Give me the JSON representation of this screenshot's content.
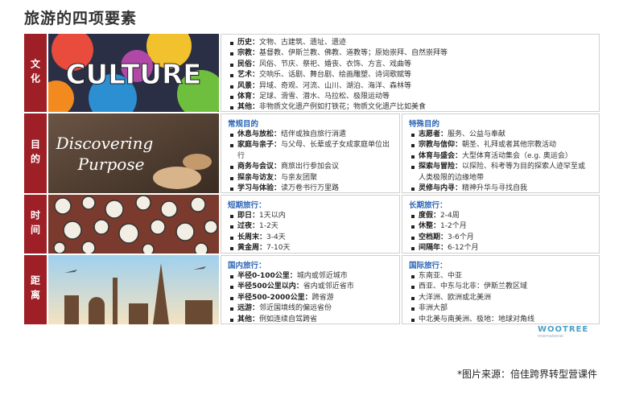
{
  "title": "旅游的四项要素",
  "photos": {
    "culture_word": "CULTURE",
    "discover_line1": "Discovering",
    "discover_line2": "Purpose"
  },
  "rows": {
    "culture": {
      "label": "文化",
      "items": [
        {
          "k": "历史：",
          "v": "文物、古建筑、遗址、遗迹"
        },
        {
          "k": "宗教：",
          "v": "基督教、伊斯兰教、佛教、道教等；原始崇拜、自然崇拜等"
        },
        {
          "k": "民俗：",
          "v": "风俗、节庆、祭祀、婚丧、衣饰、方言、戏曲等"
        },
        {
          "k": "艺术：",
          "v": "交响乐、话剧、舞台剧、绘画雕塑、诗词歌赋等"
        },
        {
          "k": "风景：",
          "v": "异域、奇观、河流、山川、湖泊、海洋、森林等"
        },
        {
          "k": "体育：",
          "v": "足球、滑雪、潜水、马拉松、极限运动等"
        },
        {
          "k": "其他：",
          "v": "非物质文化遗产例如打铁花；物质文化遗产比如美食"
        }
      ]
    },
    "purpose": {
      "label": "目的",
      "left": {
        "title": "常规目的",
        "items": [
          {
            "k": "休息与放松：",
            "v": "结伴或独自旅行消遣"
          },
          {
            "k": "家庭与亲子：",
            "v": "与父母、长辈或子女成家庭单位出行"
          },
          {
            "k": "商务与会议：",
            "v": "商旅出行参加会议"
          },
          {
            "k": "探亲与访友：",
            "v": "与亲友团聚"
          },
          {
            "k": "学习与体验：",
            "v": "读万卷书行万里路"
          }
        ]
      },
      "right": {
        "title": "特殊目的",
        "items": [
          {
            "k": "志愿者：",
            "v": "服务、公益与奉献"
          },
          {
            "k": "宗教与信仰：",
            "v": "朝圣、礼拜或者其他宗教活动"
          },
          {
            "k": "体育与盛会：",
            "v": "大型体育活动集会（e.g. 奥运会）"
          },
          {
            "k": "探索与冒险：",
            "v": "以探险、科考等为目的探索人迹罕至或人类极限的边缘地带"
          },
          {
            "k": "灵修与内寻：",
            "v": "精神升华与寻找自我"
          }
        ]
      }
    },
    "time": {
      "label": "时间",
      "left": {
        "title": "短期旅行：",
        "items": [
          {
            "k": "即日：",
            "v": "1天以内"
          },
          {
            "k": "过夜：",
            "v": "1-2天"
          },
          {
            "k": "长周末：",
            "v": "3-4天"
          },
          {
            "k": "黄金周：",
            "v": "7-10天"
          }
        ]
      },
      "right": {
        "title": "长期旅行：",
        "items": [
          {
            "k": "度假：",
            "v": "2-4周"
          },
          {
            "k": "休整：",
            "v": "1-2个月"
          },
          {
            "k": "空档期：",
            "v": "3-6个月"
          },
          {
            "k": "间隔年：",
            "v": "6-12个月"
          }
        ]
      }
    },
    "distance": {
      "label": "距离",
      "left": {
        "title": "国内旅行：",
        "items": [
          {
            "k": "半径0-100公里：",
            "v": "城内或邻近城市"
          },
          {
            "k": "半径500公里以内：",
            "v": "省内或邻近省市"
          },
          {
            "k": "半径500-2000公里：",
            "v": "跨省游"
          },
          {
            "k": "远游：",
            "v": "邻近国境线的偏远省份"
          },
          {
            "k": "其他：",
            "v": "例如连续自驾跨省"
          }
        ]
      },
      "right": {
        "title": "国际旅行：",
        "items": [
          {
            "k": "",
            "v": "东南亚、中亚"
          },
          {
            "k": "",
            "v": "西亚、中东与北非：伊斯兰教区域"
          },
          {
            "k": "",
            "v": "大洋洲、欧洲或北美洲"
          },
          {
            "k": "",
            "v": "非洲大部"
          },
          {
            "k": "",
            "v": "中北美与南美洲、极地：地球对角线"
          }
        ]
      }
    }
  },
  "logo": {
    "name": "WOOTREE",
    "sub": "international"
  },
  "source": "*图片来源：倍佳跨界转型营课件"
}
